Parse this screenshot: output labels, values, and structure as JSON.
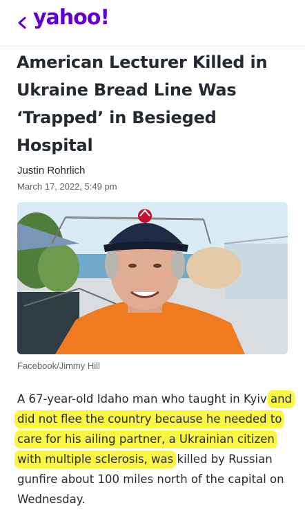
{
  "header": {
    "back_icon": "chevron-left-icon",
    "logo_text": "yahoo!",
    "brand_color": "#6001d2"
  },
  "article": {
    "headline": "American Lecturer Killed in Ukraine Bread Line Was ‘Trapped’ in Besieged Hospital",
    "author": "Justin Rohrlich",
    "date": "March 17, 2022, 5:49 pm",
    "photo_caption": "Facebook/Jimmy Hill",
    "body": {
      "part1": "A 67-year-old Idaho man who taught in Kyiv ",
      "highlighted": "and did not flee the country because he needed to care for his ailing partner, a Ukrainian citizen with multiple sclerosis, was",
      "part2": " killed by Russian gunfire about 100 miles north of the capital on Wednesday."
    },
    "highlight_color": "#fbf63f"
  }
}
